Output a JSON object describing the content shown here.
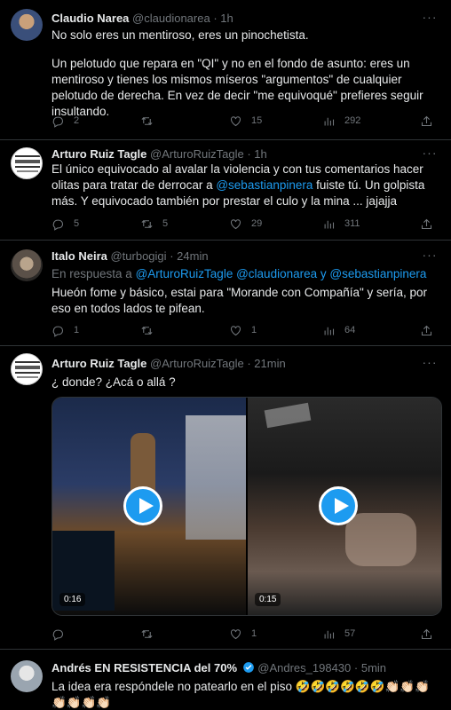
{
  "tweets": [
    {
      "name": "Claudio Narea",
      "handle": "@claudionarea",
      "time": "1h",
      "text_lines": [
        "No solo eres un mentiroso, eres un pinochetista."
      ],
      "text2": "Un pelotudo que repara en \"QI\" y no en el fondo de asunto: eres un mentiroso y tienes los mismos míseros \"argumentos\" de cualquier pelotudo de derecha. En vez de decir \"me equivoqué\" prefieres seguir insultando.",
      "replies": "2",
      "retweets": "",
      "likes": "15",
      "views": "292"
    },
    {
      "name": "Arturo Ruiz Tagle",
      "handle": "@ArturoRuizTagle",
      "time": "1h",
      "text_pre": "El único equivocado al avalar la violencia y con tus comentarios hacer olitas para tratar de derrocar a ",
      "mention": "@sebastianpinera",
      "text_post": " fuiste tú. Un golpista más. Y equivocado también por prestar el culo y la mina ... jajajja",
      "replies": "5",
      "retweets": "5",
      "likes": "29",
      "views": "311"
    },
    {
      "name": "Italo Neira",
      "handle": "@turbogigi",
      "time": "24min",
      "reply_label": "En respuesta a",
      "reply_m1": "@ArturoRuizTagle",
      "reply_m2": "@claudionarea",
      "reply_and": "y",
      "reply_m3": "@sebastianpinera",
      "text": "Hueón fome y básico, estai para \"Morande con Compañía\" y sería, por eso en todos lados te pifean.",
      "replies": "1",
      "retweets": "",
      "likes": "1",
      "views": "64"
    },
    {
      "name": "Arturo Ruiz Tagle",
      "handle": "@ArturoRuizTagle",
      "time": "21min",
      "text": "¿ donde? ¿Acá o allá ?",
      "video1_duration": "0:16",
      "video2_duration": "0:15",
      "replies": "",
      "retweets": "",
      "likes": "1",
      "views": "57"
    },
    {
      "name": "Andrés EN RESISTENCIA del 70%",
      "handle": "@Andres_198430",
      "time": "5min",
      "text": "La idea era respóndele no patearlo en el piso 🤣🤣🤣🤣🤣🤣👏🏻👏🏻👏🏻👏🏻👏🏻👏🏻👏🏻"
    }
  ],
  "separator": "·",
  "more": "···",
  "colors": {
    "accent": "#1d9bf0",
    "muted": "#71767b",
    "text": "#e7e9ea"
  },
  "icons": [
    "reply-icon",
    "retweet-icon",
    "like-icon",
    "views-icon",
    "share-icon",
    "play-icon",
    "verified-icon"
  ]
}
